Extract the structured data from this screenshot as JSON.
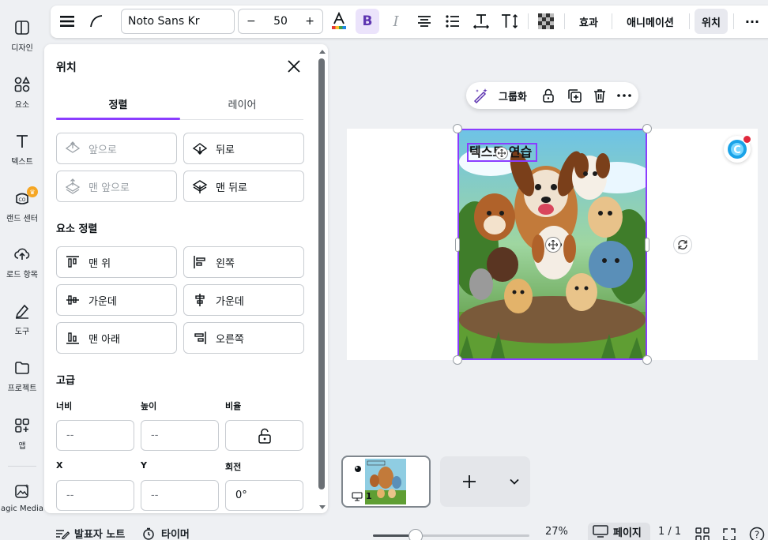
{
  "rail": {
    "items": [
      {
        "label": "디자인",
        "icon": "layout-icon"
      },
      {
        "label": "요소",
        "icon": "shapes-icon"
      },
      {
        "label": "텍스트",
        "icon": "text-icon"
      },
      {
        "label": "랜드 센터",
        "icon": "brand-icon",
        "badge": "♛"
      },
      {
        "label": "로드 항목",
        "icon": "upload-icon"
      },
      {
        "label": "도구",
        "icon": "draw-icon"
      },
      {
        "label": "프로젝트",
        "icon": "folder-icon"
      },
      {
        "label": "앱",
        "icon": "apps-icon"
      },
      {
        "label": "agic Media",
        "icon": "magic-media-icon"
      }
    ]
  },
  "toolbar": {
    "font": "Noto Sans Kr",
    "size_minus": "−",
    "size": "50",
    "size_plus": "+",
    "bold": "B",
    "italic": "I",
    "effects": "효과",
    "animation": "애니메이션",
    "position": "위치",
    "more": "···"
  },
  "panel": {
    "title": "위치",
    "tabs": [
      "정렬",
      "레이어"
    ],
    "layer_buttons": [
      {
        "label": "앞으로",
        "disabled": true
      },
      {
        "label": "뒤로",
        "disabled": false
      },
      {
        "label": "맨 앞으로",
        "disabled": true
      },
      {
        "label": "맨 뒤로",
        "disabled": false
      }
    ],
    "align_section": "요소 정렬",
    "align_buttons": [
      "맨 위",
      "왼쪽",
      "가운데",
      "가운데",
      "맨 아래",
      "오른쪽"
    ],
    "advanced_section": "고급",
    "fields": {
      "width_label": "너비",
      "width_value": "--",
      "height_label": "높이",
      "height_value": "--",
      "ratio_label": "비율",
      "x_label": "X",
      "x_value": "--",
      "y_label": "Y",
      "y_value": "--",
      "rotation_label": "회전",
      "rotation_value": "0°"
    }
  },
  "canvas": {
    "text_box": "텍스트 연습",
    "float_toolbar": {
      "group": "그룹화"
    }
  },
  "pages": {
    "thumb_number": "1"
  },
  "bottom": {
    "notes": "발표자 노트",
    "timer": "타이머",
    "zoom": "27%",
    "pages_label": "페이지",
    "page_count": "1 / 1"
  },
  "colors": {
    "accent": "#8b3dff",
    "bold_bg": "#ebe3fb"
  }
}
